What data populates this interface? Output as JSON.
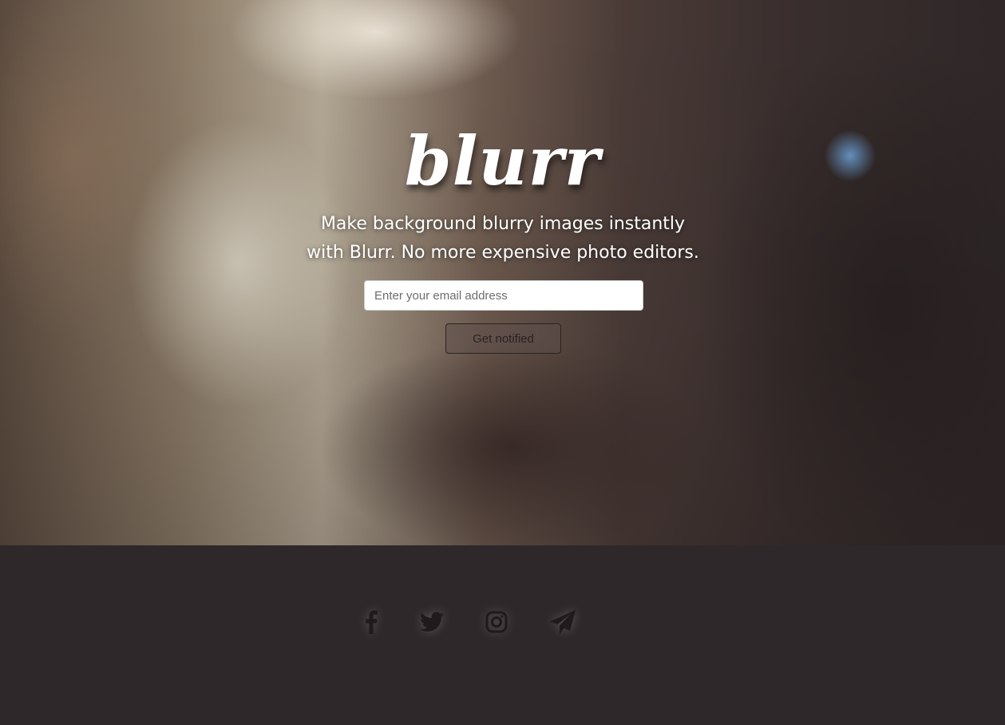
{
  "hero": {
    "logo": "blurr",
    "tagline_line1": "Make background blurry images instantly",
    "tagline_line2": "with Blurr. No more expensive photo editors.",
    "email_placeholder": "Enter your email address",
    "email_value": "",
    "notify_label": "Get notified"
  },
  "footer": {
    "social_icons": [
      "facebook-icon",
      "twitter-icon",
      "instagram-icon",
      "telegram-icon"
    ]
  },
  "colors": {
    "footer_background": "#2e282a",
    "icon_color": "#1f1a1b",
    "text_color": "#ffffff"
  }
}
